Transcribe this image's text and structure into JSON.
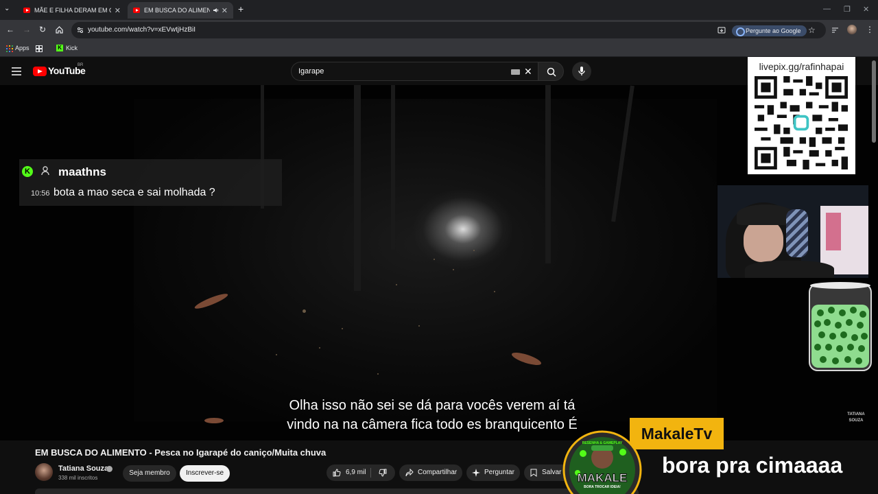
{
  "browser": {
    "tabs": [
      {
        "label": "MÃE E FILHA DERAM EM CIMA",
        "close": "✕"
      },
      {
        "label": "EM BUSCA DO ALIMENTO",
        "close": "✕"
      }
    ],
    "new_tab": "+",
    "url": "youtube.com/watch?v=xEVwtjHzBiI",
    "google_button": "Pergunte ao Google",
    "bookmarks": [
      {
        "label": "Apps"
      },
      {
        "label": "Kick"
      }
    ]
  },
  "youtube": {
    "logo_text": "YouTube",
    "country_code": "BR",
    "search_value": "Igarape"
  },
  "chat_overlay": {
    "platform_icon": "K",
    "username": "maathns",
    "time": "10:56",
    "message": "bota a mao seca e sai molhada ?"
  },
  "subtitle": {
    "line1": "Olha isso não sei se dá para vocês verem aí tá",
    "line2": "vindo na na câmera fica todo es branquicento É"
  },
  "watermark": {
    "line1": "TATIANA",
    "line2": "SOUZA"
  },
  "qr_panel": {
    "title": "livepix.gg/rafinhapai"
  },
  "streamer_overlay": {
    "badge": "MakaleTv",
    "banner": "bora pra cimaaaa",
    "logo_text": "MAKALE",
    "logo_top": "RESENHA & GAMEPLAY",
    "logo_bottom": "BORA TROCAR IDEIA!"
  },
  "video": {
    "title": "EM BUSCA DO ALIMENTO - Pesca no Igarapé do caniço/Muita chuva",
    "channel": "Tatiana Souza",
    "subscribers": "338 mil inscritos",
    "join_label": "Seja membro",
    "subscribe_label": "Inscrever-se",
    "likes": "6,9 mil",
    "share_label": "Compartilhar",
    "ask_label": "Perguntar",
    "save_label": "Salvar"
  },
  "colors": {
    "kick_green": "#53fc18",
    "youtube_red": "#ff0000",
    "badge_yellow": "#f2b40f"
  }
}
